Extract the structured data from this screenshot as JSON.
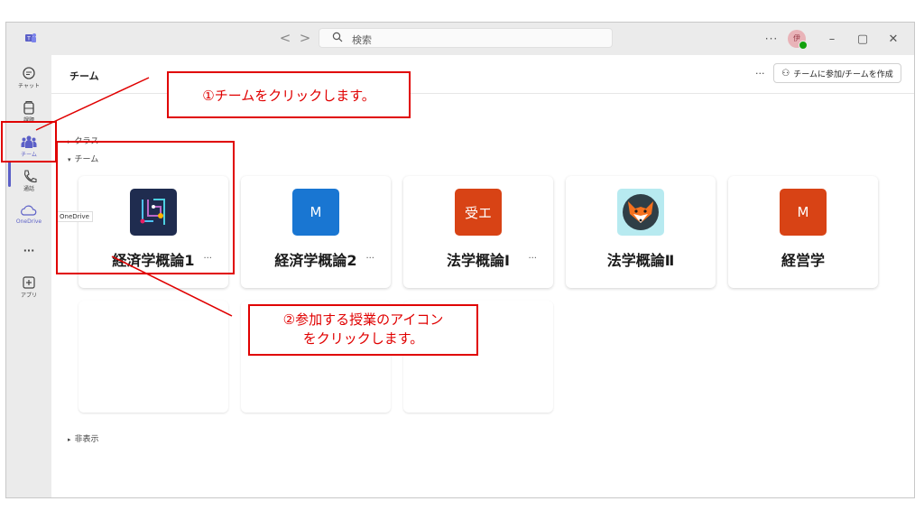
{
  "titlebar": {
    "back_glyph": "<",
    "forward_glyph": ">",
    "search_placeholder": "検索",
    "more_glyph": "···",
    "avatar_initials": "伊",
    "minimize_glyph": "–",
    "restore_glyph": "▢",
    "close_glyph": "✕"
  },
  "rail": {
    "items": [
      {
        "label": "チャット",
        "icon": "chat-icon"
      },
      {
        "label": "課題",
        "icon": "backpack-icon"
      },
      {
        "label": "チーム",
        "icon": "teams-icon"
      },
      {
        "label": "通話",
        "icon": "phone-icon"
      },
      {
        "label": "OneDrive",
        "icon": "cloud-icon"
      },
      {
        "label": "",
        "icon": "more-icon"
      },
      {
        "label": "アプリ",
        "icon": "add-app-icon"
      }
    ],
    "more_glyph": "···"
  },
  "header": {
    "title": "チーム",
    "more_glyph": "···",
    "join_button": "チームに参加/チームを作成"
  },
  "sections": {
    "classes": "クラス",
    "teams": "チーム",
    "hidden": "非表示"
  },
  "teams": [
    {
      "name": "経済学概論1",
      "tile_text": "",
      "tile_color": "#1f2c4f",
      "more": "···"
    },
    {
      "name": "経済学概論2",
      "tile_text": "M",
      "tile_color": "#1976d2",
      "more": "···"
    },
    {
      "name": "法学概論Ⅰ",
      "tile_text": "受エ",
      "tile_color": "#d84315",
      "more": "···"
    },
    {
      "name": "法学概論Ⅱ",
      "tile_text": "",
      "tile_color": "#b7eaf0",
      "more": ""
    },
    {
      "name": "経営学",
      "tile_text": "M",
      "tile_color": "#d84315",
      "more": ""
    }
  ],
  "tooltip": "OneDrive",
  "annotations": {
    "step1": "①チームをクリックします。",
    "step2_line1": "②参加する授業のアイコン",
    "step2_line2": "をクリックします。",
    "color": "#e00000"
  }
}
